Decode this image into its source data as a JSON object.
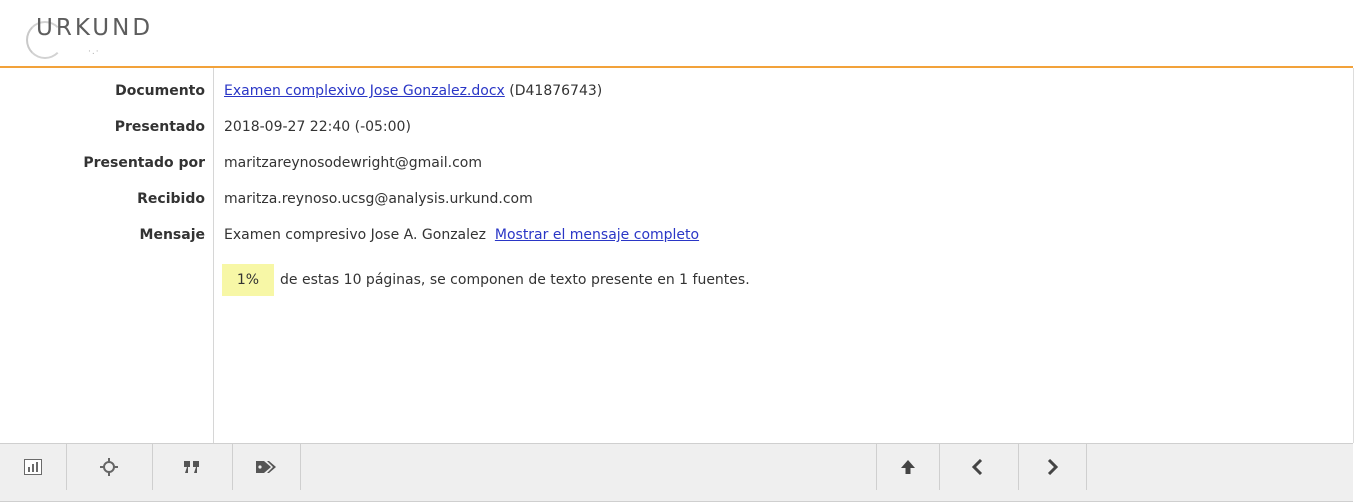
{
  "header": {
    "logo_text": "URKUND"
  },
  "details": {
    "documento_label": "Documento",
    "documento_link": "Examen complexivo Jose Gonzalez.docx",
    "documento_id": " (D41876743)",
    "presentado_label": "Presentado",
    "presentado_value": "2018-09-27 22:40 (-05:00)",
    "presentado_por_label": "Presentado por",
    "presentado_por_value": "maritzareynosodewright@gmail.com",
    "recibido_label": "Recibido",
    "recibido_value": "maritza.reynoso.ucsg@analysis.urkund.com",
    "mensaje_label": "Mensaje",
    "mensaje_value": "Examen compresivo Jose A. Gonzalez",
    "mensaje_link": "Mostrar el mensaje completo"
  },
  "match": {
    "percent": "1%",
    "text": "de estas 10 páginas, se componen de texto presente en 1 fuentes.",
    "highlight_color": "#f7f7a6"
  },
  "toolbar": {
    "icons": [
      "bar-chart-icon",
      "crosshair-icon",
      "quote-icon",
      "tags-icon",
      "arrow-up-icon",
      "chevron-left-icon",
      "chevron-right-icon"
    ]
  },
  "colors": {
    "accent": "#f2a23a",
    "link": "#2a36c6"
  }
}
